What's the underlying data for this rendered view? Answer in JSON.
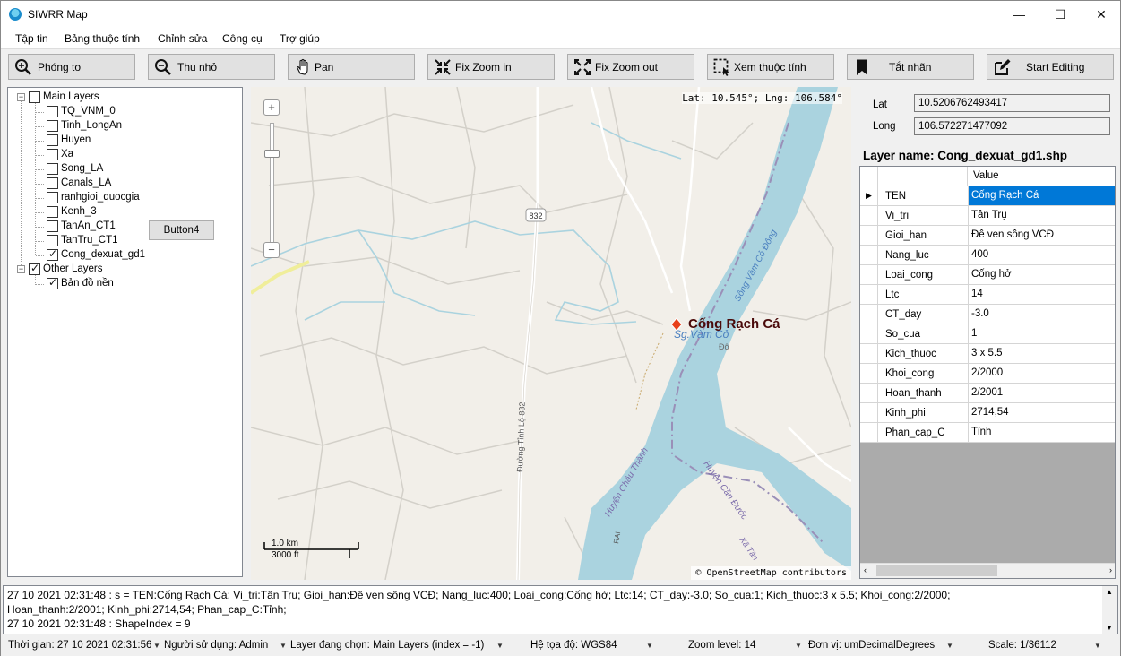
{
  "window": {
    "title": "SIWRR Map",
    "controls": [
      "—",
      "☐",
      "✕"
    ]
  },
  "menu": [
    "Tập tin",
    "Bảng thuộc tính",
    "Chỉnh sửa",
    "Công cụ",
    "Trợ giúp"
  ],
  "toolbar": [
    {
      "label": "Phóng to",
      "icon": "zoom-in-icon"
    },
    {
      "label": "Thu nhỏ",
      "icon": "zoom-out-icon"
    },
    {
      "label": "Pan",
      "icon": "hand-icon"
    },
    {
      "label": "Fix Zoom in",
      "icon": "fix-zoom-in-icon"
    },
    {
      "label": "Fix Zoom out",
      "icon": "fix-zoom-out-icon"
    },
    {
      "label": "Xem thuộc tính",
      "icon": "select-info-icon"
    },
    {
      "label": "Tắt nhãn",
      "icon": "bookmark-icon"
    },
    {
      "label": "Start Editing",
      "icon": "edit-icon"
    }
  ],
  "tree": {
    "root": {
      "label": "Main Layers",
      "checked": false
    },
    "main_layers": [
      {
        "label": "TQ_VNM_0",
        "checked": false
      },
      {
        "label": "Tinh_LongAn",
        "checked": false
      },
      {
        "label": "Huyen",
        "checked": false
      },
      {
        "label": "Xa",
        "checked": false
      },
      {
        "label": "Song_LA",
        "checked": false
      },
      {
        "label": "Canals_LA",
        "checked": false
      },
      {
        "label": "ranhgioi_quocgia",
        "checked": false
      },
      {
        "label": "Kenh_3",
        "checked": false
      },
      {
        "label": "TanAn_CT1",
        "checked": false
      },
      {
        "label": "TanTru_CT1",
        "checked": false
      },
      {
        "label": "Cong_dexuat_gd1",
        "checked": true
      }
    ],
    "other": {
      "label": "Other Layers",
      "checked": true
    },
    "other_layers": [
      {
        "label": "Bản đồ nền",
        "checked": true
      }
    ],
    "button4": "Button4"
  },
  "map": {
    "coord_readout": "Lat: 10.545°; Lng: 106.584°",
    "zoom_plus": "+",
    "zoom_minus": "−",
    "scale_km": "1.0 km",
    "scale_ft": "3000 ft",
    "attribution": "© OpenStreetMap contributors",
    "marker_label": "Cống Rạch Cá",
    "road_badge": "832",
    "labels": {
      "river1": "Sg.Vàm Cỏ",
      "river2": "Sông Vàm Cỏ Đông",
      "road": "Đường Tỉnh Lộ 832",
      "district1": "Huyện Châu Thành",
      "district2": "Huyện Cần Đước",
      "commune": "Xã Tân",
      "misc1": "Đô",
      "misc2": "RAI"
    },
    "colors": {
      "land": "#f2efe9",
      "water": "#aad3df",
      "road": "#ffffff",
      "minor_road": "#c8c8c8",
      "marker": "#e8401a"
    }
  },
  "coords": {
    "lat_label": "Lat",
    "lat_value": "10.5206762493417",
    "long_label": "Long",
    "long_value": "106.572271477092"
  },
  "layer_name": "Layer name: Cong_dexuat_gd1.shp",
  "grid": {
    "value_header": "Value",
    "rows": [
      {
        "name": "TEN",
        "value": "Cống Rạch Cá",
        "current": true
      },
      {
        "name": "Vi_tri",
        "value": "Tân Trụ"
      },
      {
        "name": "Gioi_han",
        "value": "Đê ven sông VCĐ"
      },
      {
        "name": "Nang_luc",
        "value": "400"
      },
      {
        "name": "Loai_cong",
        "value": "Cống hở"
      },
      {
        "name": "Ltc",
        "value": "14"
      },
      {
        "name": "CT_day",
        "value": "-3.0"
      },
      {
        "name": "So_cua",
        "value": "1"
      },
      {
        "name": "Kich_thuoc",
        "value": "3 x 5.5"
      },
      {
        "name": "Khoi_cong",
        "value": "2/2000"
      },
      {
        "name": "Hoan_thanh",
        "value": "2/2001"
      },
      {
        "name": "Kinh_phi",
        "value": "2714,54"
      },
      {
        "name": "Phan_cap_C",
        "value": "Tỉnh"
      }
    ]
  },
  "log": [
    "27 10 2021 02:31:48 : s = TEN:Cống Rạch Cá; Vi_tri:Tân Trụ; Gioi_han:Đê ven sông VCĐ; Nang_luc:400; Loai_cong:Cống hở; Ltc:14; CT_day:-3.0; So_cua:1; Kich_thuoc:3 x 5.5; Khoi_cong:2/2000;",
    "Hoan_thanh:2/2001; Kinh_phi:2714,54; Phan_cap_C:Tỉnh;",
    "27 10 2021 02:31:48 : ShapeIndex = 9"
  ],
  "status": {
    "time": "Thời gian: 27 10 2021 02:31:56",
    "user": "Người sử dụng: Admin",
    "layer": "Layer đang chọn: Main Layers (index = -1)",
    "crs": "Hệ tọa độ: WGS84",
    "zoom": "Zoom level: 14",
    "units": "Đơn vị: umDecimalDegrees",
    "scale": "Scale: 1/36112"
  }
}
